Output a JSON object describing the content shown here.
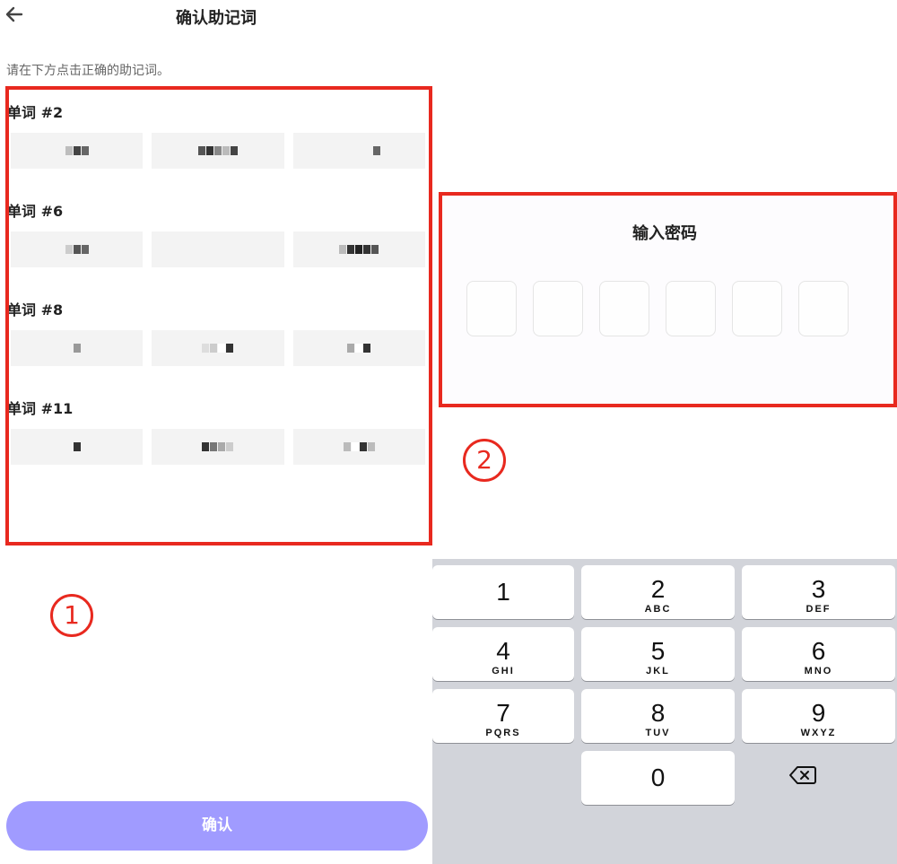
{
  "header": {
    "title": "确认助记词",
    "back_icon": "arrow-left-icon"
  },
  "instruction": "请在下方点击正确的助记词。",
  "word_groups": [
    {
      "label": "单词 #2"
    },
    {
      "label": "单词 #6"
    },
    {
      "label": "单词 #8"
    },
    {
      "label": "单词 #11"
    }
  ],
  "confirm_button": {
    "label": "确认",
    "color": "#a09bff"
  },
  "annotations": {
    "marker_1": "1",
    "marker_2": "2",
    "highlight_color": "#e8291f"
  },
  "password_dialog": {
    "title": "输入密码",
    "cell_count": 6
  },
  "keypad": {
    "keys": [
      {
        "digit": "1",
        "letters": ""
      },
      {
        "digit": "2",
        "letters": "ABC"
      },
      {
        "digit": "3",
        "letters": "DEF"
      },
      {
        "digit": "4",
        "letters": "GHI"
      },
      {
        "digit": "5",
        "letters": "JKL"
      },
      {
        "digit": "6",
        "letters": "MNO"
      },
      {
        "digit": "7",
        "letters": "PQRS"
      },
      {
        "digit": "8",
        "letters": "TUV"
      },
      {
        "digit": "9",
        "letters": "WXYZ"
      },
      {
        "digit": "0",
        "letters": ""
      }
    ],
    "delete_icon": "backspace-icon"
  }
}
